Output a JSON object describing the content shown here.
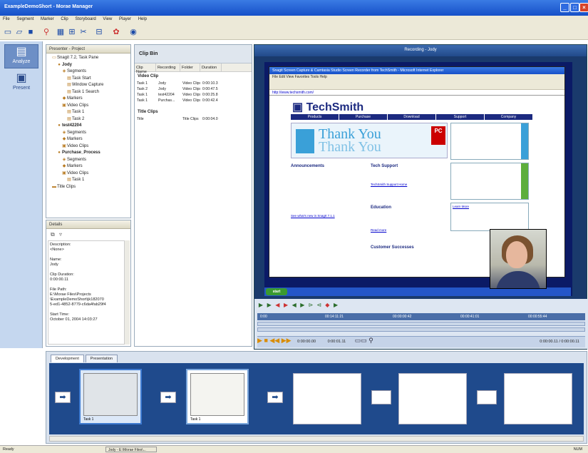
{
  "window": {
    "title": "ExampleDemoShort - Morae Manager"
  },
  "menu": [
    "File",
    "Segment",
    "Marker",
    "Clip",
    "Storyboard",
    "View",
    "Player",
    "Help"
  ],
  "nav": {
    "analyze": "Analyze",
    "present": "Present"
  },
  "project": {
    "header": "Presenter - Project",
    "tree": [
      {
        "label": "Snagit 7.2, Task Pane",
        "indent": 1,
        "icon": "folder-icon"
      },
      {
        "label": "Jody",
        "indent": 2,
        "icon": "person-icon",
        "bold": true
      },
      {
        "label": "Segments",
        "indent": 3,
        "icon": "segment-icon"
      },
      {
        "label": "Task Start",
        "indent": 4,
        "icon": "clip-icon"
      },
      {
        "label": "Window Capture",
        "indent": 4,
        "icon": "clip-icon"
      },
      {
        "label": "Task 1 Search",
        "indent": 4,
        "icon": "clip-icon"
      },
      {
        "label": "Markers",
        "indent": 3,
        "icon": "marker-icon"
      },
      {
        "label": "Video Clips",
        "indent": 3,
        "icon": "video-icon"
      },
      {
        "label": "Task 1",
        "indent": 4,
        "icon": "clip-icon"
      },
      {
        "label": "Task 2",
        "indent": 4,
        "icon": "clip-icon"
      },
      {
        "label": "test42204",
        "indent": 2,
        "icon": "person-icon",
        "bold": true
      },
      {
        "label": "Segments",
        "indent": 3,
        "icon": "segment-icon"
      },
      {
        "label": "Markers",
        "indent": 3,
        "icon": "marker-icon"
      },
      {
        "label": "Video Clips",
        "indent": 3,
        "icon": "video-icon"
      },
      {
        "label": "Purchase_Process",
        "indent": 2,
        "icon": "person-icon",
        "bold": true
      },
      {
        "label": "Segments",
        "indent": 3,
        "icon": "segment-icon"
      },
      {
        "label": "Markers",
        "indent": 3,
        "icon": "marker-icon"
      },
      {
        "label": "Video Clips",
        "indent": 3,
        "icon": "video-icon"
      },
      {
        "label": "Task 1",
        "indent": 4,
        "icon": "clip-icon"
      },
      {
        "label": "Title Clips",
        "indent": 1,
        "icon": "title-icon"
      }
    ]
  },
  "details": {
    "header": "Details",
    "lines": [
      "Description:",
      "<None>",
      "",
      "Name:",
      "Jody",
      "",
      "Clip Duration:",
      "0:00:00.11",
      "",
      "File Path:",
      "E:\\Morae Files\\Projects",
      "\\ExampleDemoShort\\jk182070",
      "5-ed1-4852-8779-c6da4fab29f4",
      "",
      "Start Time:",
      "October 01, 2004 14:03:27"
    ]
  },
  "clipbin": {
    "title": "Clip Bin",
    "columns": [
      "Clip Name",
      "Recording",
      "Folder",
      "Duration"
    ],
    "groups": [
      {
        "name": "Video Clip",
        "rows": [
          [
            "Task 1",
            "Jody",
            "Video Clips",
            "0:00:10.3"
          ],
          [
            "Task 2",
            "Jody",
            "Video Clips",
            "0:00:47.5"
          ],
          [
            "Task 1",
            "test42204",
            "Video Clips",
            "0:00:25.8"
          ],
          [
            "Task 1",
            "Purchas...",
            "Video Clips",
            "0:00:42.4"
          ]
        ]
      },
      {
        "name": "Title Clips",
        "rows": [
          [
            "Title",
            "",
            "Title Clips",
            "0:00:04.0"
          ]
        ]
      }
    ]
  },
  "recording": {
    "header": "Recording - Jody",
    "browser_title": "Snagit Screen Capture & Camtasia Studio Screen Recorder from TechSmith - Microsoft Internet Explorer",
    "browser_menu": "File  Edit  View  Favorites  Tools  Help",
    "address": "http://www.techsmith.com/",
    "logo": "TechSmith",
    "nav_tabs": [
      "Products",
      "Purchase",
      "Download",
      "Support",
      "Company"
    ],
    "thankyou": "Thank You",
    "pcmag": "PC",
    "sections": {
      "announcements": "Announcements",
      "tech_support": "Tech Support",
      "education": "Education",
      "customer_success": "Customer Successes"
    },
    "links": {
      "see_whats_new": "See what's new in SnagIt 7.1.1",
      "tech_support_home": "TechSmith Support Home",
      "learn_more": "Learn More",
      "read_more": "Read more"
    },
    "taskbar_start": "start"
  },
  "timeline": {
    "ticks": [
      "0:00",
      "00:14:11:21",
      "00:00:00:42",
      "00:00:41:01",
      "00:00:55:44"
    ],
    "time_left": "0:00:00.00",
    "time_mid": "0:00:01.11",
    "time_right": "0:00:00.11 / 0:00:00.11"
  },
  "storyboard": {
    "tabs": [
      "Development",
      "Presentation"
    ],
    "clips": [
      "Task 1",
      "Task 1"
    ]
  },
  "statusbar": {
    "left": "Ready",
    "box": "Jody - E:\\Morae Files\\...",
    "right": "NUM"
  }
}
